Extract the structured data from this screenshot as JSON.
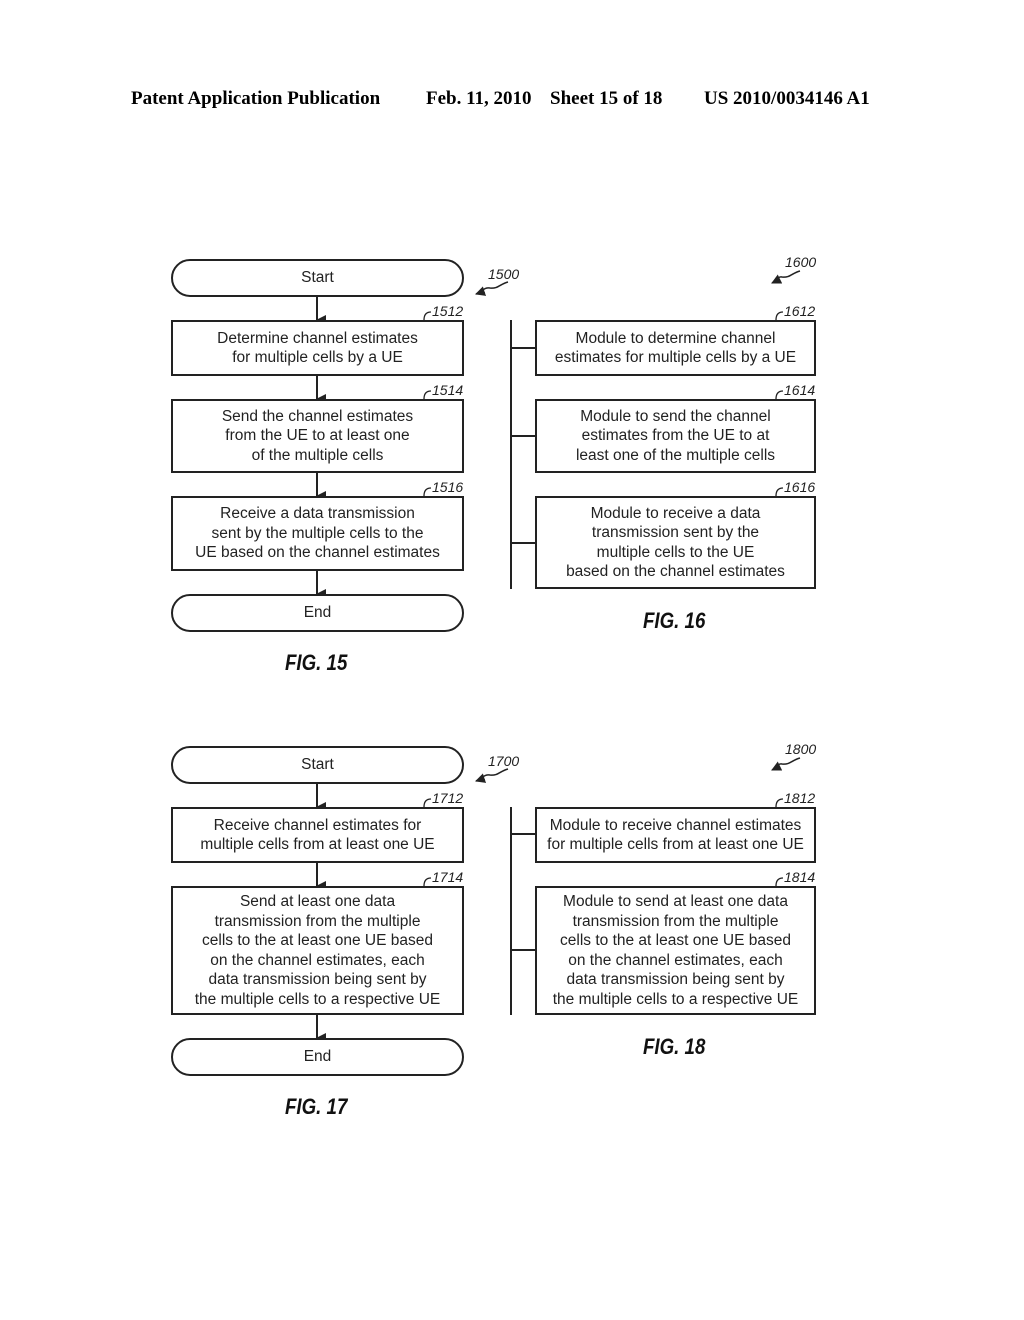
{
  "header": {
    "publication": "Patent Application Publication",
    "date": "Feb. 11, 2010",
    "sheet": "Sheet 15 of 18",
    "number": "US 2010/0034146 A1"
  },
  "fig15": {
    "ref": "1500",
    "start": "Start",
    "end": "End",
    "steps": [
      {
        "ref": "1512",
        "text": "Determine channel estimates\nfor multiple cells by a UE"
      },
      {
        "ref": "1514",
        "text": "Send the channel estimates\nfrom the UE to at least one\nof the multiple cells"
      },
      {
        "ref": "1516",
        "text": "Receive a data transmission\nsent by the multiple cells to the\nUE based on the channel estimates"
      }
    ],
    "caption": "FIG. 15"
  },
  "fig16": {
    "ref": "1600",
    "modules": [
      {
        "ref": "1612",
        "text": "Module to determine channel\nestimates for multiple cells by a UE"
      },
      {
        "ref": "1614",
        "text": "Module to send the channel\nestimates from the UE to at\nleast one of the multiple cells"
      },
      {
        "ref": "1616",
        "text": "Module to receive a data\ntransmission sent by the\nmultiple cells to the UE\nbased on the channel estimates"
      }
    ],
    "caption": "FIG. 16"
  },
  "fig17": {
    "ref": "1700",
    "start": "Start",
    "end": "End",
    "steps": [
      {
        "ref": "1712",
        "text": "Receive channel estimates for\nmultiple cells from at least one UE"
      },
      {
        "ref": "1714",
        "text": "Send at least one data\ntransmission from the multiple\ncells to the at least one UE based\non the channel estimates, each\ndata transmission being sent by\nthe multiple cells to a respective UE"
      }
    ],
    "caption": "FIG. 17"
  },
  "fig18": {
    "ref": "1800",
    "modules": [
      {
        "ref": "1812",
        "text": "Module to receive channel estimates\nfor multiple cells from at least one UE"
      },
      {
        "ref": "1814",
        "text": "Module to send at least one data\ntransmission from the multiple\ncells to the at least one UE based\non the channel estimates, each\ndata transmission being sent by\nthe multiple cells to a respective UE"
      }
    ],
    "caption": "FIG. 18"
  }
}
